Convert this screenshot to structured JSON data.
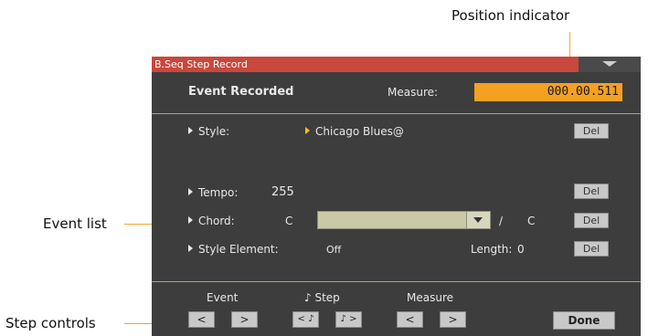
{
  "callouts": {
    "position_indicator": "Position indicator",
    "event_list": "Event list",
    "step_controls": "Step controls"
  },
  "window": {
    "title": "B.Seq Step Record",
    "menu_icon": "triangle-down-icon"
  },
  "header": {
    "event_recorded": "Event Recorded",
    "measure_label": "Measure:",
    "measure_value": "000.00.511"
  },
  "events": {
    "style": {
      "label": "Style:",
      "value": "Chicago Blues@",
      "del": "Del"
    },
    "tempo": {
      "label": "Tempo:",
      "value": "255",
      "del": "Del"
    },
    "chord": {
      "label": "Chord:",
      "root": "C",
      "slash": "/",
      "bass": "C",
      "del": "Del"
    },
    "style_element": {
      "label": "Style Element:",
      "value": "Off",
      "length_label": "Length:",
      "length_value": "0",
      "del": "Del"
    }
  },
  "footer": {
    "event_label": "Event",
    "step_label": "♪ Step",
    "measure_label": "Measure",
    "prev": "<",
    "next": ">",
    "step_prev": "< ♪",
    "step_next": "♪ >",
    "done": "Done"
  },
  "colors": {
    "title_bar": "#c9473c",
    "background": "#3d3d3d",
    "accent": "#f5a023"
  }
}
